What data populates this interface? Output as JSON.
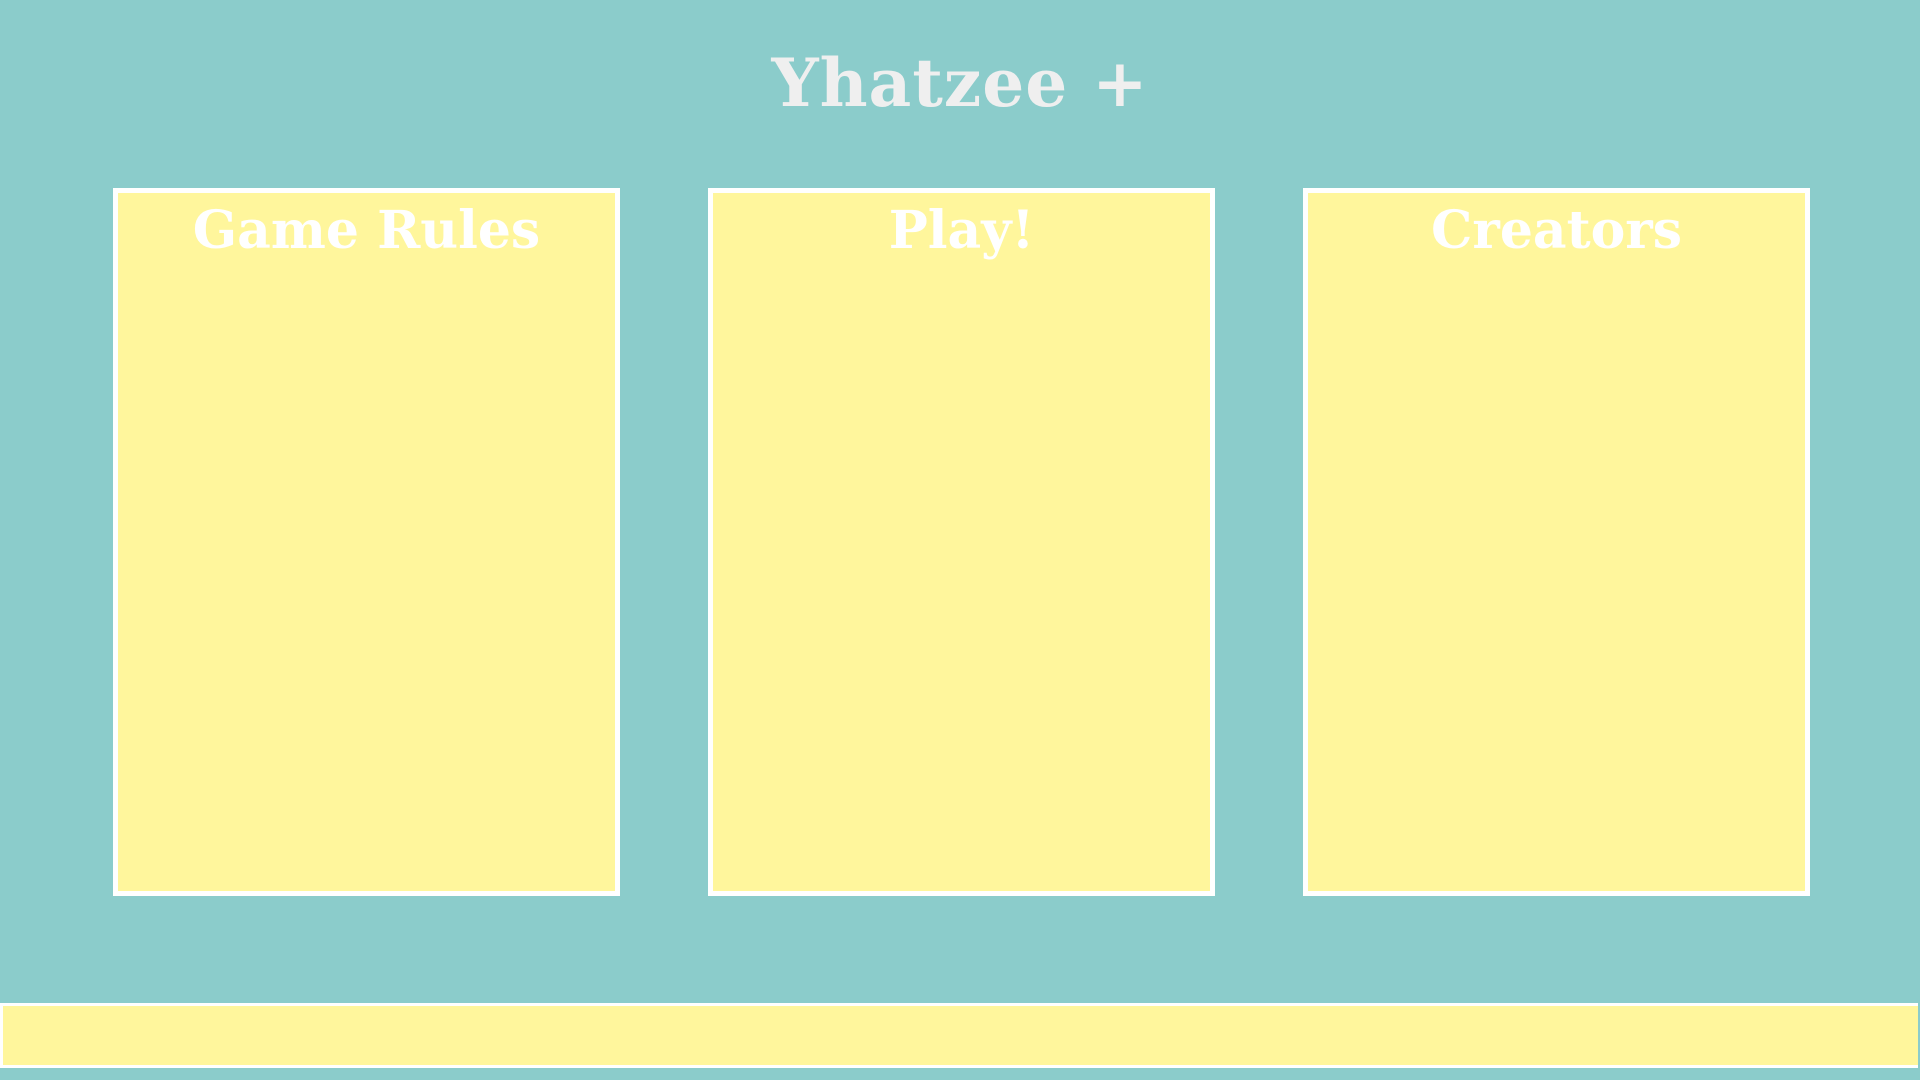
{
  "header": {
    "title": "Yhatzee +"
  },
  "cards": [
    {
      "label": "Game Rules"
    },
    {
      "label": "Play!"
    },
    {
      "label": "Creators"
    }
  ],
  "colors": {
    "background": "#8bcccb",
    "card_fill": "#fff69c",
    "card_border": "#ffffff",
    "title_text": "#efefef",
    "card_title_text": "#ffffff"
  }
}
